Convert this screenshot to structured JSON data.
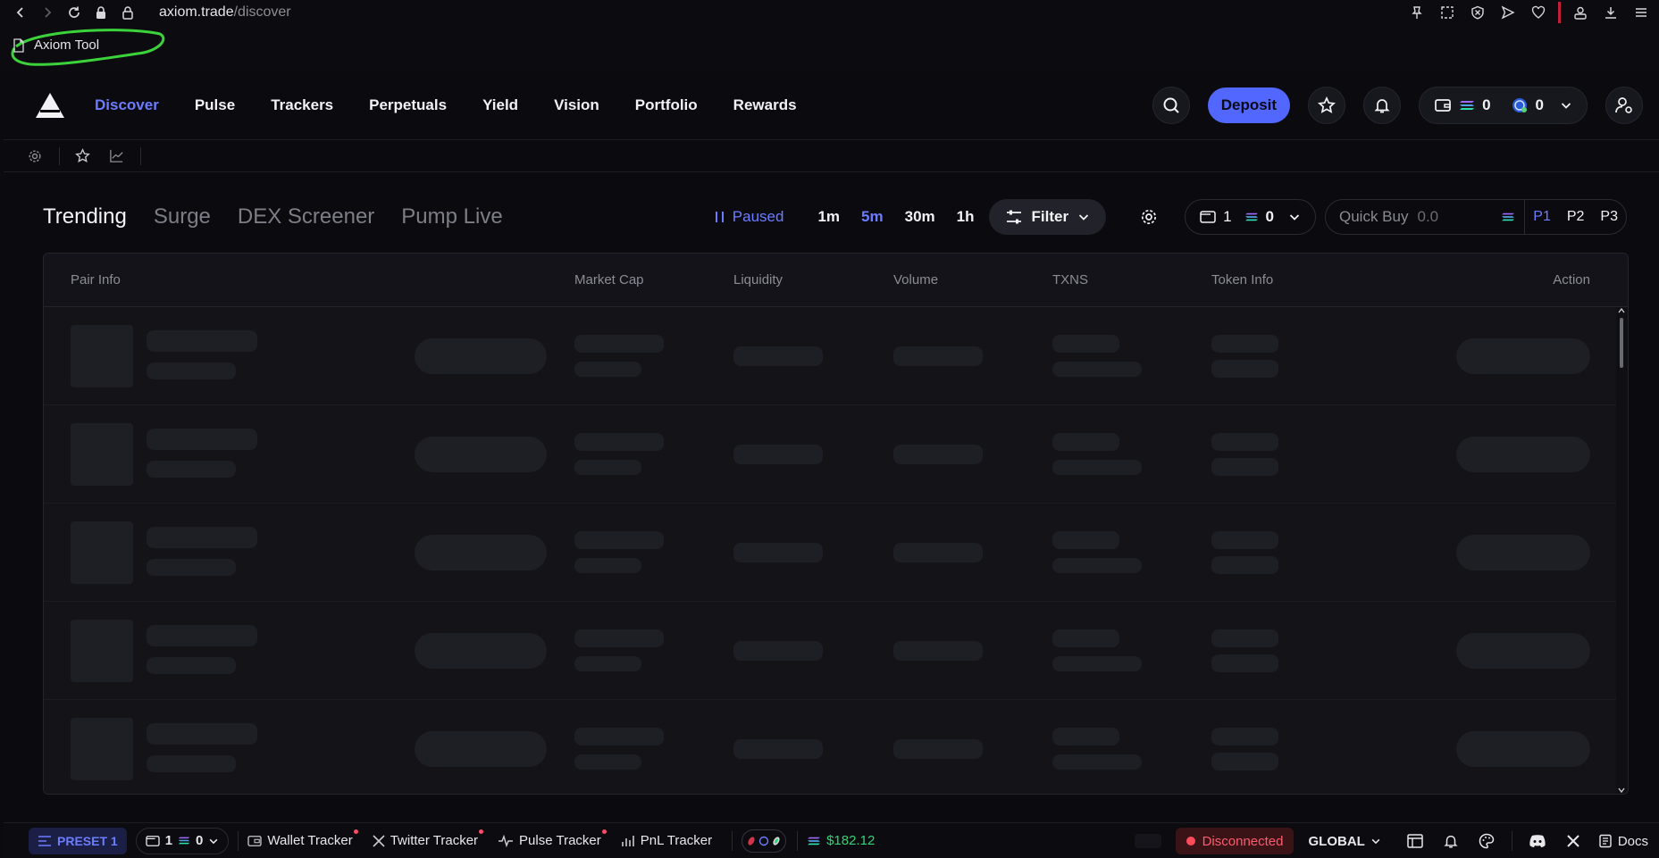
{
  "browser": {
    "url_host": "axiom.trade",
    "url_path": "/discover",
    "bookmark": "Axiom Tool"
  },
  "nav": {
    "links": [
      "Discover",
      "Pulse",
      "Trackers",
      "Perpetuals",
      "Yield",
      "Vision",
      "Portfolio",
      "Rewards"
    ],
    "active": "Discover",
    "deposit": "Deposit",
    "sol_balance": "0",
    "usd_balance": "0"
  },
  "tabs": {
    "items": [
      "Trending",
      "Surge",
      "DEX Screener",
      "Pump Live"
    ],
    "active": "Trending"
  },
  "controls": {
    "paused": "Paused",
    "times": [
      "1m",
      "5m",
      "30m",
      "1h"
    ],
    "active_time": "5m",
    "filter": "Filter",
    "wallet_count": "1",
    "wallet_balance": "0",
    "quick_buy_label": "Quick Buy",
    "quick_buy_value": "0.0",
    "presets": [
      "P1",
      "P2",
      "P3"
    ],
    "active_preset": "P1"
  },
  "table": {
    "columns": [
      "Pair Info",
      "Market Cap",
      "Liquidity",
      "Volume",
      "TXNS",
      "Token Info",
      "Action"
    ]
  },
  "footer": {
    "preset": "PRESET 1",
    "wallet_count": "1",
    "wallet_balance": "0",
    "trackers": [
      "Wallet Tracker",
      "Twitter Tracker",
      "Pulse Tracker",
      "PnL Tracker"
    ],
    "balance": "$182.12",
    "status": "Disconnected",
    "region": "GLOBAL",
    "docs": "Docs"
  },
  "colors": {
    "accent": "#5267ff",
    "accent_text": "#6c7cff",
    "positive": "#34d27a",
    "danger": "#ff4a5c"
  }
}
